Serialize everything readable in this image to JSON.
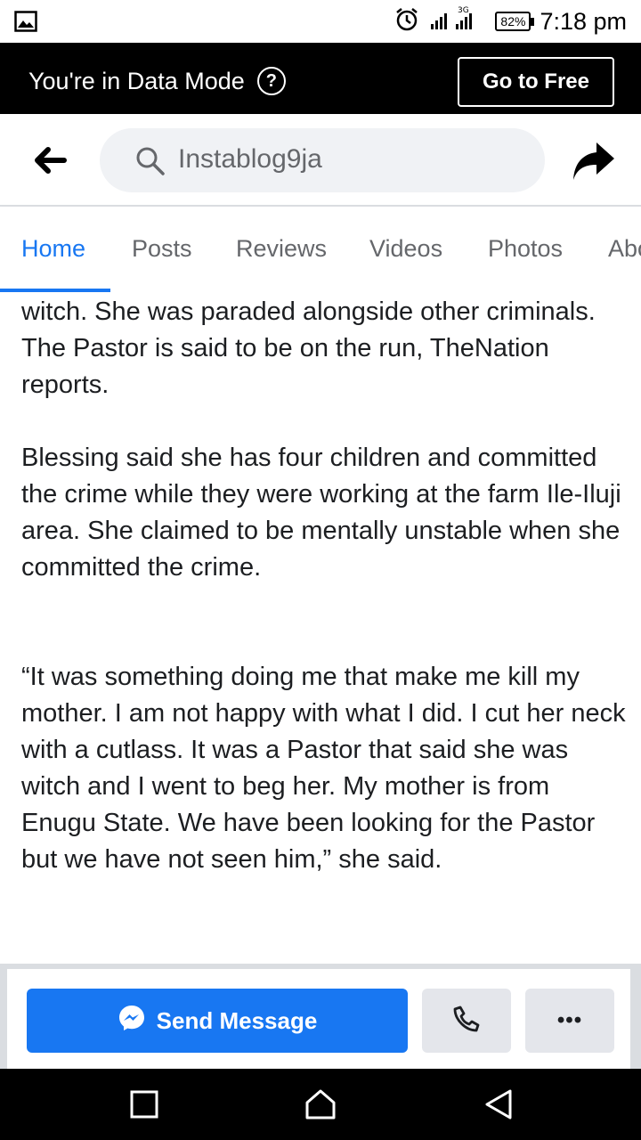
{
  "status_bar": {
    "battery": "82%",
    "network": "3G",
    "time": "7:18 pm",
    "icons": [
      "image-icon",
      "alarm-icon",
      "signal-icon",
      "battery-icon"
    ]
  },
  "data_mode": {
    "message": "You're in Data Mode",
    "help_symbol": "?",
    "button_label": "Go to Free"
  },
  "header": {
    "search_query": "Instablog9ja",
    "icons": [
      "back-arrow-icon",
      "search-icon",
      "share-icon"
    ]
  },
  "tabs": [
    {
      "label": "Home",
      "active": true
    },
    {
      "label": "Posts",
      "active": false
    },
    {
      "label": "Reviews",
      "active": false
    },
    {
      "label": "Videos",
      "active": false
    },
    {
      "label": "Photos",
      "active": false
    },
    {
      "label": "Abo",
      "active": false
    }
  ],
  "post": {
    "paragraphs": [
      "witch. She was paraded alongside other criminals. The Pastor is said to be on the run, TheNation reports.",
      "Blessing said she has four children and committed the crime while they were working at the farm Ile-Iluji area. She claimed to be mentally unstable when she committed the crime.",
      "“It was something doing me that make me kill my mother. I am not happy with what I did. I cut her neck with a cutlass. It was a Pastor that said she was witch and I went to beg her. My mother is from Enugu State. We have been looking for the Pastor but we have not seen him,” she said."
    ]
  },
  "actions": {
    "send_message_label": "Send Message",
    "more_label": "•••",
    "icons": [
      "messenger-icon",
      "phone-icon",
      "more-icon"
    ]
  },
  "nav": {
    "icons": [
      "recents-icon",
      "home-icon",
      "back-icon"
    ]
  },
  "colors": {
    "accent": "#1877f2",
    "banner_bg": "#000000",
    "search_bg": "#f0f2f5",
    "secondary_button_bg": "#e4e6eb"
  }
}
